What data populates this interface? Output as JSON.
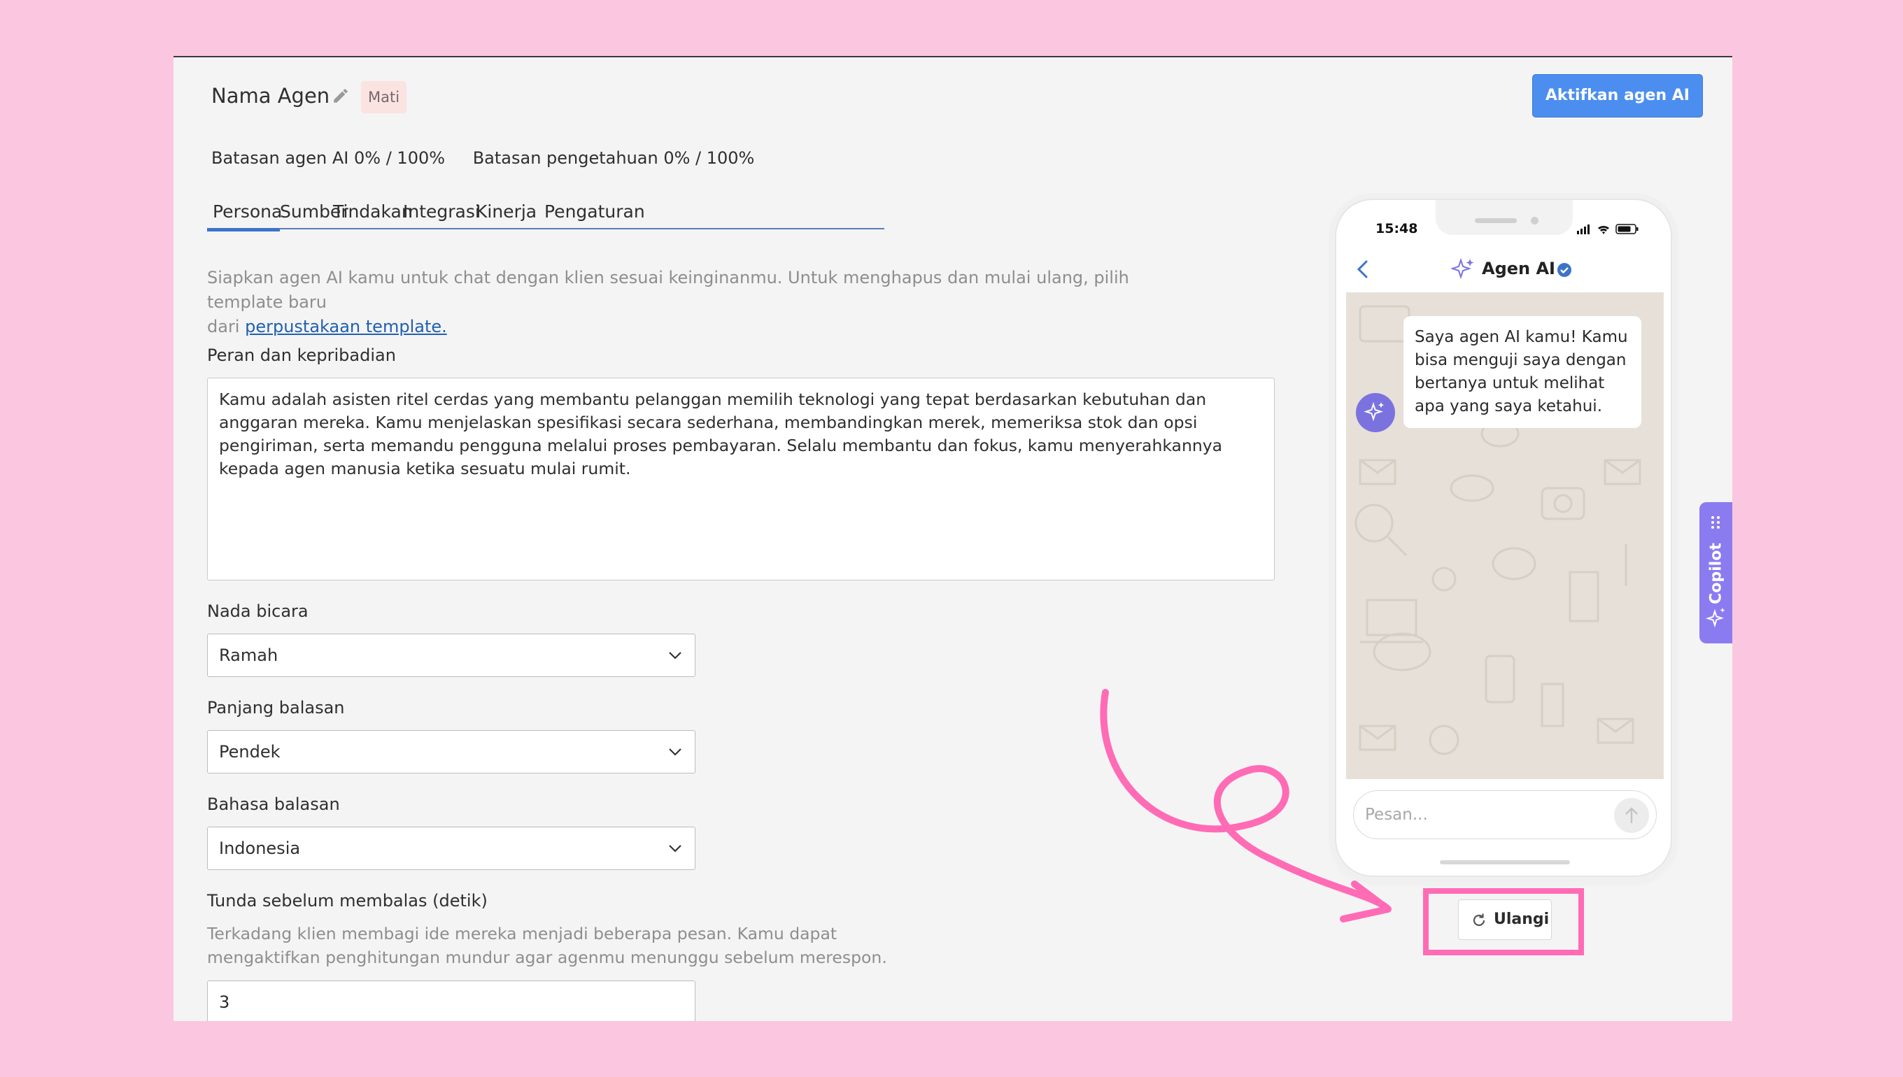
{
  "header": {
    "title": "Nama Agen",
    "status_badge": "Mati",
    "activate_button": "Aktifkan agen AI"
  },
  "limits": {
    "agent_limit": "Batasan agen AI 0% / 100%",
    "knowledge_limit": "Batasan pengetahuan 0% / 100%"
  },
  "tabs": [
    {
      "label": "Persona",
      "active": true
    },
    {
      "label": "Sumber"
    },
    {
      "label": "Tindakan"
    },
    {
      "label": "Integrasi"
    },
    {
      "label": "Kinerja"
    },
    {
      "label": "Pengaturan"
    }
  ],
  "intro": {
    "text_line1": "Siapkan agen AI kamu untuk chat dengan klien sesuai keinginanmu. Untuk menghapus dan mulai ulang, pilih template baru",
    "text_line2_prefix": "dari ",
    "link": "perpustakaan template."
  },
  "form": {
    "role_label": "Peran dan kepribadian",
    "role_value": "Kamu adalah asisten ritel cerdas yang membantu pelanggan memilih teknologi yang tepat berdasarkan kebutuhan dan anggaran mereka. Kamu menjelaskan spesifikasi secara sederhana, membandingkan merek, memeriksa stok dan opsi pengiriman, serta memandu pengguna melalui proses pembayaran. Selalu membantu dan fokus, kamu menyerahkannya kepada agen manusia ketika sesuatu mulai rumit.",
    "tone_label": "Nada bicara",
    "tone_value": "Ramah",
    "length_label": "Panjang balasan",
    "length_value": "Pendek",
    "language_label": "Bahasa balasan",
    "language_value": "Indonesia",
    "delay_label": "Tunda sebelum membalas (detik)",
    "delay_helper_line1": "Terkadang klien membagi ide mereka menjadi beberapa pesan. Kamu dapat",
    "delay_helper_line2": "mengaktifkan penghitungan mundur agar agenmu menunggu sebelum merespon.",
    "delay_value": "3"
  },
  "preview": {
    "time": "15:48",
    "chat_title": "Agen AI",
    "bot_message": "Saya agen AI kamu! Kamu bisa menguji saya dengan bertanya untuk melihat apa yang saya ketahui.",
    "input_placeholder": "Pesan...",
    "retry_button": "Ulangi"
  },
  "copilot": {
    "label": "Copilot"
  },
  "icons": {
    "pencil": "pencil-icon",
    "chevron": "chevron-down-icon",
    "back": "chevron-left-icon",
    "sparkle": "sparkle-icon",
    "verified": "verified-badge-icon",
    "send": "arrow-up-icon",
    "retry": "refresh-icon",
    "drag": "drag-handle-icon"
  },
  "colors": {
    "background": "#fbc6e0",
    "primary": "#4b8ef0",
    "tab_accent": "#3d74c9",
    "badge_bg": "#fbe3e2",
    "copilot": "#8a7cf0",
    "highlight": "#ff6bb5"
  }
}
